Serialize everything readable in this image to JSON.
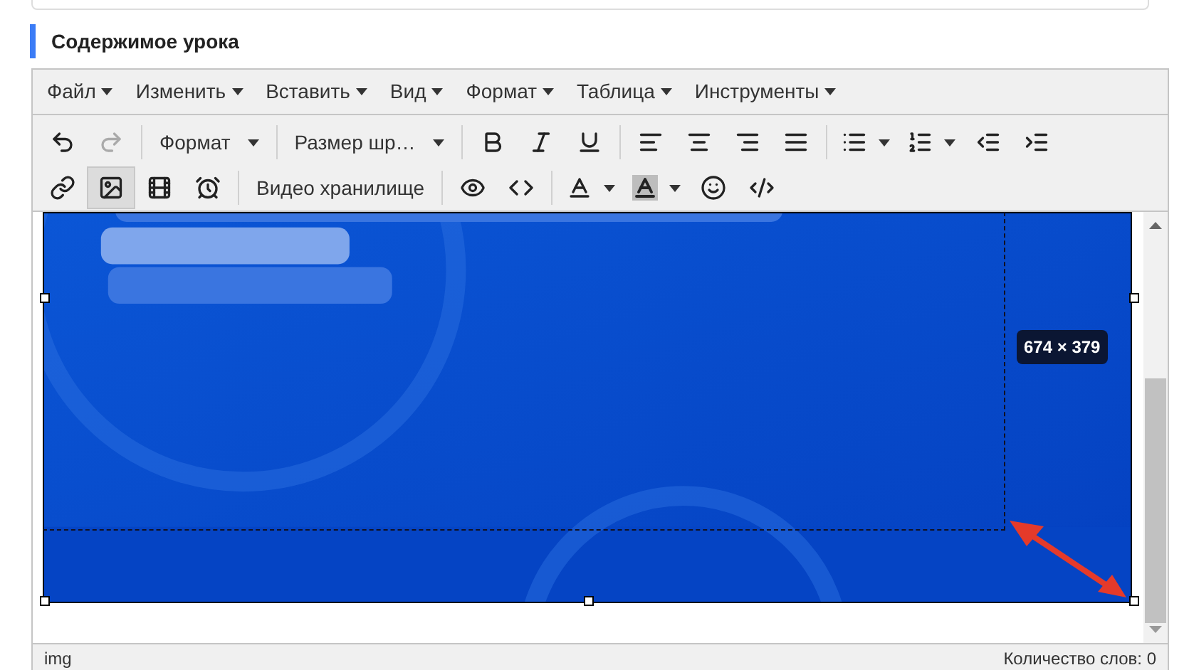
{
  "section_title": "Содержимое урока",
  "menu": [
    {
      "label": "Файл"
    },
    {
      "label": "Изменить"
    },
    {
      "label": "Вставить"
    },
    {
      "label": "Вид"
    },
    {
      "label": "Формат"
    },
    {
      "label": "Таблица"
    },
    {
      "label": "Инструменты"
    }
  ],
  "toolbar_rows": [
    [
      {
        "kind": "icon",
        "selected": false,
        "disabled": false
      },
      {
        "kind": "icon",
        "selected": false,
        "disabled": true
      },
      {
        "kind": "sep"
      },
      {
        "kind": "dropdown",
        "label": "Формат"
      },
      {
        "kind": "sep"
      },
      {
        "kind": "dropdown",
        "label": "Размер шр…"
      },
      {
        "kind": "sep"
      },
      {
        "kind": "icon",
        "selected": false,
        "disabled": false
      },
      {
        "kind": "icon",
        "selected": false,
        "disabled": false
      },
      {
        "kind": "icon",
        "selected": false,
        "disabled": false
      },
      {
        "kind": "sep"
      },
      {
        "kind": "icon",
        "selected": false,
        "disabled": false
      },
      {
        "kind": "icon",
        "selected": false,
        "disabled": false
      },
      {
        "kind": "icon",
        "selected": false,
        "disabled": false
      },
      {
        "kind": "icon",
        "selected": false,
        "disabled": false
      },
      {
        "kind": "sep"
      },
      {
        "kind": "split",
        "selected": false,
        "disabled": false
      },
      {
        "kind": "split",
        "selected": false,
        "disabled": false
      },
      {
        "kind": "icon",
        "selected": false,
        "disabled": false
      },
      {
        "kind": "icon",
        "selected": false,
        "disabled": false
      }
    ],
    [
      {
        "kind": "icon",
        "selected": false,
        "disabled": false
      },
      {
        "kind": "icon",
        "selected": true,
        "disabled": false
      },
      {
        "kind": "icon",
        "selected": false,
        "disabled": false
      },
      {
        "kind": "icon",
        "selected": false,
        "disabled": false
      },
      {
        "kind": "sep"
      },
      {
        "kind": "text",
        "label": "Видео хранилище"
      },
      {
        "kind": "sep"
      },
      {
        "kind": "icon",
        "selected": false,
        "disabled": false
      },
      {
        "kind": "icon",
        "selected": false,
        "disabled": false
      },
      {
        "kind": "sep"
      },
      {
        "kind": "split",
        "selected": false,
        "disabled": false
      },
      {
        "kind": "split",
        "selected": false,
        "disabled": false
      },
      {
        "kind": "icon",
        "selected": false,
        "disabled": false
      },
      {
        "kind": "icon",
        "selected": false,
        "disabled": false
      }
    ]
  ],
  "image": {
    "kind": "picture",
    "size_tooltip": "674 × 379"
  },
  "status_bar": {
    "path": "img",
    "word_count": "Количество слов: 0"
  }
}
